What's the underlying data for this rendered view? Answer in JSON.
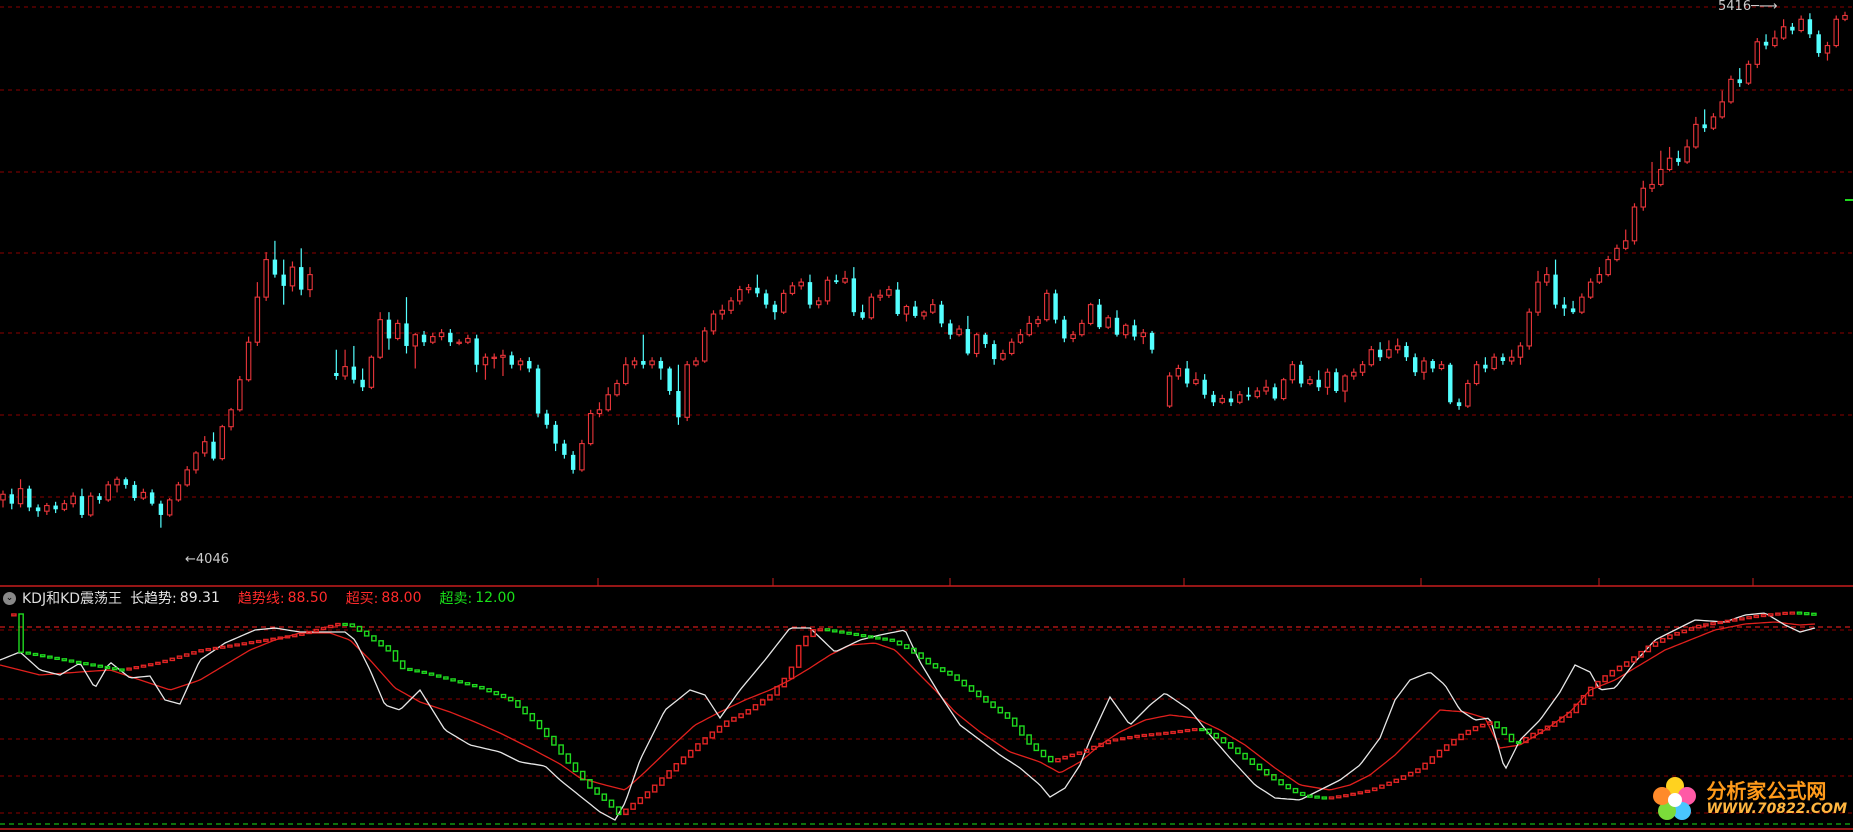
{
  "indicator": {
    "name": "KDJ和KD震荡王",
    "params": [
      {
        "label": "长趋势:",
        "value": "89.31",
        "color": "white"
      },
      {
        "label": "趋势线:",
        "value": "88.50",
        "color": "red"
      },
      {
        "label": "超买:",
        "value": "88.00",
        "color": "red"
      },
      {
        "label": "超卖:",
        "value": "12.00",
        "color": "green"
      }
    ]
  },
  "price_labels": {
    "low": "4046",
    "high": "5416"
  },
  "watermark": {
    "title": "分析家公式网",
    "url": "WWW.70822.COM"
  },
  "colors": {
    "up": "#e8353a",
    "down": "#54ffff",
    "grid": "#8b0000",
    "white_line": "#e6e6e6",
    "red_line": "#e0201d",
    "step_up": "#e02424",
    "step_down": "#1fd91f"
  },
  "chart_data": {
    "type": "candlestick",
    "price_range": [
      3960,
      5430
    ],
    "candles": [
      [
        4120,
        4135,
        4100,
        4145
      ],
      [
        4135,
        4110,
        4095,
        4150
      ],
      [
        4110,
        4150,
        4100,
        4175
      ],
      [
        4150,
        4100,
        4090,
        4158
      ],
      [
        4100,
        4090,
        4075,
        4108
      ],
      [
        4090,
        4105,
        4080,
        4112
      ],
      [
        4105,
        4095,
        4085,
        4115
      ],
      [
        4095,
        4110,
        4090,
        4120
      ],
      [
        4110,
        4130,
        4100,
        4140
      ],
      [
        4130,
        4080,
        4072,
        4150
      ],
      [
        4080,
        4130,
        4075,
        4140
      ],
      [
        4130,
        4120,
        4110,
        4138
      ],
      [
        4120,
        4160,
        4115,
        4170
      ],
      [
        4160,
        4175,
        4140,
        4182
      ],
      [
        4175,
        4160,
        4150,
        4180
      ],
      [
        4160,
        4125,
        4118,
        4170
      ],
      [
        4125,
        4140,
        4120,
        4150
      ],
      [
        4140,
        4110,
        4105,
        4148
      ],
      [
        4110,
        4080,
        4046,
        4118
      ],
      [
        4080,
        4120,
        4075,
        4125
      ],
      [
        4120,
        4160,
        4115,
        4168
      ],
      [
        4160,
        4200,
        4155,
        4210
      ],
      [
        4200,
        4245,
        4190,
        4250
      ],
      [
        4245,
        4275,
        4235,
        4290
      ],
      [
        4275,
        4230,
        4225,
        4300
      ],
      [
        4230,
        4315,
        4225,
        4320
      ],
      [
        4315,
        4360,
        4305,
        4365
      ],
      [
        4360,
        4440,
        4355,
        4450
      ],
      [
        4440,
        4540,
        4435,
        4555
      ],
      [
        4540,
        4660,
        4530,
        4700
      ],
      [
        4660,
        4760,
        4650,
        4780
      ],
      [
        4760,
        4720,
        4712,
        4810
      ],
      [
        4720,
        4690,
        4640,
        4760
      ],
      [
        4690,
        4740,
        4675,
        4755
      ],
      [
        4740,
        4680,
        4665,
        4790
      ],
      [
        4680,
        4720,
        4660,
        4740
      ],
      null,
      null,
      [
        4458,
        4450,
        4440,
        4520
      ],
      [
        4450,
        4475,
        4440,
        4520
      ],
      [
        4475,
        4440,
        4430,
        4530
      ],
      [
        4440,
        4420,
        4410,
        4470
      ],
      [
        4420,
        4500,
        4415,
        4505
      ],
      [
        4500,
        4600,
        4495,
        4620
      ],
      [
        4600,
        4550,
        4520,
        4620
      ],
      [
        4550,
        4590,
        4545,
        4600
      ],
      [
        4590,
        4530,
        4510,
        4660
      ],
      [
        4530,
        4560,
        4470,
        4565
      ],
      [
        4560,
        4540,
        4530,
        4570
      ],
      [
        4540,
        4555,
        4535,
        4565
      ],
      [
        4555,
        4565,
        4545,
        4575
      ],
      [
        4565,
        4540,
        4530,
        4575
      ],
      [
        4540,
        4540,
        4532,
        4548
      ],
      [
        4540,
        4550,
        4535,
        4560
      ],
      [
        4550,
        4480,
        4460,
        4560
      ],
      [
        4480,
        4500,
        4440,
        4510
      ],
      [
        4500,
        4500,
        4470,
        4510
      ],
      [
        4500,
        4505,
        4450,
        4520
      ],
      [
        4505,
        4480,
        4470,
        4515
      ],
      [
        4480,
        4490,
        4465,
        4498
      ],
      [
        4490,
        4470,
        4460,
        4500
      ],
      [
        4470,
        4350,
        4340,
        4480
      ],
      [
        4350,
        4320,
        4310,
        4360
      ],
      [
        4320,
        4270,
        4250,
        4330
      ],
      [
        4270,
        4240,
        4230,
        4280
      ],
      [
        4240,
        4200,
        4190,
        4250
      ],
      [
        4200,
        4270,
        4195,
        4280
      ],
      [
        4270,
        4350,
        4265,
        4360
      ],
      [
        4350,
        4360,
        4340,
        4380
      ],
      [
        4360,
        4400,
        4355,
        4420
      ],
      [
        4400,
        4430,
        4395,
        4440
      ],
      [
        4430,
        4480,
        4425,
        4500
      ],
      [
        4480,
        4490,
        4470,
        4500
      ],
      [
        4490,
        4480,
        4470,
        4560
      ],
      [
        4480,
        4490,
        4470,
        4500
      ],
      [
        4490,
        4470,
        4440,
        4500
      ],
      [
        4470,
        4410,
        4400,
        4475
      ],
      [
        4410,
        4340,
        4320,
        4480
      ],
      [
        4340,
        4480,
        4330,
        4490
      ],
      [
        4480,
        4490,
        4475,
        4500
      ],
      [
        4490,
        4570,
        4485,
        4580
      ],
      [
        4570,
        4615,
        4560,
        4625
      ],
      [
        4615,
        4625,
        4600,
        4640
      ],
      [
        4625,
        4650,
        4615,
        4660
      ],
      [
        4650,
        4680,
        4640,
        4690
      ],
      [
        4680,
        4685,
        4670,
        4695
      ],
      [
        4685,
        4670,
        4660,
        4720
      ],
      [
        4670,
        4640,
        4630,
        4680
      ],
      [
        4640,
        4620,
        4600,
        4650
      ],
      [
        4620,
        4670,
        4615,
        4680
      ],
      [
        4670,
        4690,
        4665,
        4700
      ],
      [
        4690,
        4700,
        4680,
        4710
      ],
      [
        4700,
        4640,
        4630,
        4720
      ],
      [
        4640,
        4650,
        4630,
        4660
      ],
      [
        4650,
        4705,
        4640,
        4715
      ],
      [
        4705,
        4700,
        4695,
        4720
      ],
      [
        4700,
        4710,
        4695,
        4730
      ],
      [
        4710,
        4620,
        4610,
        4740
      ],
      [
        4620,
        4605,
        4600,
        4640
      ],
      [
        4605,
        4660,
        4600,
        4670
      ],
      [
        4660,
        4665,
        4650,
        4680
      ],
      [
        4665,
        4680,
        4658,
        4690
      ],
      [
        4680,
        4615,
        4610,
        4700
      ],
      [
        4615,
        4635,
        4595,
        4640
      ],
      [
        4635,
        4610,
        4605,
        4650
      ],
      [
        4610,
        4620,
        4600,
        4625
      ],
      [
        4620,
        4640,
        4615,
        4655
      ],
      [
        4640,
        4590,
        4580,
        4650
      ],
      [
        4590,
        4560,
        4548,
        4600
      ],
      [
        4560,
        4575,
        4555,
        4585
      ],
      [
        4575,
        4510,
        4505,
        4610
      ],
      [
        4510,
        4560,
        4500,
        4565
      ],
      [
        4560,
        4535,
        4525,
        4565
      ],
      [
        4535,
        4495,
        4480,
        4545
      ],
      [
        4495,
        4510,
        4490,
        4520
      ],
      [
        4510,
        4540,
        4505,
        4550
      ],
      [
        4540,
        4560,
        4535,
        4575
      ],
      [
        4560,
        4590,
        4555,
        4610
      ],
      [
        4590,
        4600,
        4580,
        4610
      ],
      [
        4600,
        4670,
        4595,
        4680
      ],
      [
        4670,
        4600,
        4590,
        4680
      ],
      [
        4600,
        4550,
        4540,
        4610
      ],
      [
        4550,
        4560,
        4540,
        4570
      ],
      [
        4560,
        4590,
        4555,
        4600
      ],
      [
        4590,
        4640,
        4585,
        4645
      ],
      [
        4640,
        4580,
        4575,
        4655
      ],
      [
        4580,
        4605,
        4575,
        4612
      ],
      [
        4605,
        4560,
        4555,
        4625
      ],
      [
        4560,
        4585,
        4550,
        4590
      ],
      [
        4585,
        4555,
        4545,
        4600
      ],
      [
        4555,
        4565,
        4535,
        4575
      ],
      [
        4565,
        4520,
        4510,
        4570
      ],
      null,
      [
        4370,
        4450,
        4365,
        4460
      ],
      [
        4450,
        4470,
        4440,
        4480
      ],
      [
        4470,
        4430,
        4420,
        4490
      ],
      [
        4430,
        4440,
        4425,
        4460
      ],
      [
        4440,
        4400,
        4390,
        4455
      ],
      [
        4400,
        4380,
        4370,
        4410
      ],
      [
        4380,
        4390,
        4375,
        4400
      ],
      [
        4390,
        4380,
        4370,
        4410
      ],
      [
        4380,
        4400,
        4375,
        4410
      ],
      [
        4400,
        4395,
        4385,
        4420
      ],
      [
        4395,
        4410,
        4390,
        4420
      ],
      [
        4410,
        4420,
        4400,
        4440
      ],
      [
        4420,
        4390,
        4385,
        4430
      ],
      [
        4390,
        4440,
        4385,
        4445
      ],
      [
        4440,
        4480,
        4430,
        4490
      ],
      [
        4480,
        4430,
        4420,
        4490
      ],
      [
        4430,
        4440,
        4425,
        4450
      ],
      [
        4440,
        4420,
        4410,
        4465
      ],
      [
        4420,
        4460,
        4400,
        4470
      ],
      [
        4460,
        4410,
        4405,
        4470
      ],
      [
        4410,
        4450,
        4380,
        4455
      ],
      [
        4450,
        4460,
        4440,
        4470
      ],
      [
        4460,
        4480,
        4450,
        4490
      ],
      [
        4480,
        4520,
        4475,
        4530
      ],
      [
        4520,
        4500,
        4490,
        4540
      ],
      [
        4500,
        4520,
        4495,
        4545
      ],
      [
        4520,
        4530,
        4510,
        4550
      ],
      [
        4530,
        4500,
        4490,
        4540
      ],
      [
        4500,
        4460,
        4450,
        4510
      ],
      [
        4460,
        4490,
        4440,
        4500
      ],
      [
        4490,
        4470,
        4460,
        4495
      ],
      [
        4470,
        4480,
        4465,
        4490
      ],
      [
        4480,
        4380,
        4375,
        4485
      ],
      [
        4380,
        4370,
        4360,
        4390
      ],
      [
        4370,
        4430,
        4365,
        4440
      ],
      [
        4430,
        4480,
        4425,
        4490
      ],
      [
        4480,
        4470,
        4460,
        4500
      ],
      [
        4470,
        4500,
        4465,
        4510
      ],
      [
        4500,
        4490,
        4480,
        4510
      ],
      [
        4490,
        4500,
        4480,
        4520
      ],
      [
        4500,
        4530,
        4480,
        4540
      ],
      [
        4530,
        4620,
        4520,
        4630
      ],
      [
        4620,
        4700,
        4610,
        4730
      ],
      [
        4700,
        4720,
        4690,
        4740
      ],
      [
        4720,
        4640,
        4630,
        4760
      ],
      [
        4640,
        4630,
        4610,
        4660
      ],
      [
        4630,
        4620,
        4615,
        4650
      ],
      [
        4620,
        4660,
        4615,
        4670
      ],
      [
        4660,
        4700,
        4655,
        4710
      ],
      [
        4700,
        4720,
        4695,
        4740
      ],
      [
        4720,
        4760,
        4715,
        4770
      ],
      [
        4760,
        4790,
        4755,
        4800
      ],
      [
        4790,
        4810,
        4785,
        4840
      ],
      [
        4810,
        4900,
        4800,
        4910
      ],
      [
        4900,
        4950,
        4890,
        4970
      ],
      [
        4950,
        4960,
        4940,
        5020
      ],
      [
        4960,
        5000,
        4955,
        5050
      ],
      [
        5000,
        5030,
        4995,
        5060
      ],
      [
        5030,
        5020,
        5010,
        5050
      ],
      [
        5020,
        5060,
        5015,
        5080
      ],
      [
        5060,
        5120,
        5055,
        5140
      ],
      [
        5120,
        5110,
        5100,
        5160
      ],
      [
        5110,
        5140,
        5105,
        5150
      ],
      [
        5140,
        5180,
        5135,
        5210
      ],
      [
        5180,
        5240,
        5175,
        5250
      ],
      [
        5240,
        5230,
        5220,
        5270
      ],
      [
        5230,
        5280,
        5225,
        5290
      ],
      [
        5280,
        5340,
        5270,
        5350
      ],
      [
        5340,
        5330,
        5320,
        5360
      ],
      [
        5330,
        5350,
        5325,
        5370
      ],
      [
        5350,
        5380,
        5345,
        5400
      ],
      [
        5380,
        5370,
        5360,
        5390
      ],
      [
        5370,
        5400,
        5365,
        5410
      ],
      [
        5400,
        5360,
        5350,
        5416
      ],
      [
        5360,
        5310,
        5300,
        5370
      ],
      [
        5310,
        5330,
        5290,
        5340
      ],
      [
        5330,
        5400,
        5325,
        5410
      ],
      [
        5400,
        5410,
        5395,
        5420
      ]
    ]
  }
}
